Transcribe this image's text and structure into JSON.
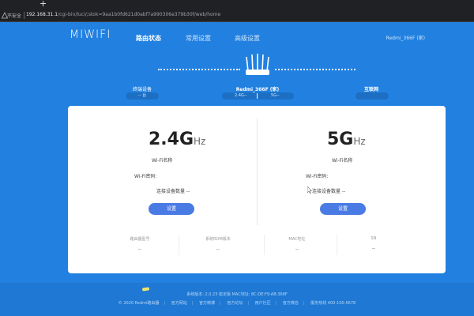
{
  "browser": {
    "new_tab": "+",
    "insecure_label": "不安全",
    "url_host": "192.168.31.1",
    "url_path": "/cgi-bin/luci/;stok=9aa1b0fd621d0abf7a990306e379b30f/web/home"
  },
  "header": {
    "logo": "MIWIFI",
    "nav": [
      "路由状态",
      "常用设置",
      "高级设置"
    ],
    "device_name": "Redmi_366F (家)"
  },
  "topology": {
    "left_label": "终端设备",
    "left_value": "-- 台",
    "center_label": "Redmi_366F (家)",
    "band_24": "2.4G--",
    "band_5": "5G--",
    "right_label": "互联网",
    "right_value": ""
  },
  "bands": [
    {
      "freq": "2.4G",
      "unit": "Hz",
      "wifi_name_label": "Wi-Fi名称",
      "wifi_pwd_label": "Wi-Fi密码:",
      "clients_label": "连接设备数量 --",
      "button": "设置"
    },
    {
      "freq": "5G",
      "unit": "Hz",
      "wifi_name_label": "Wi-Fi名称",
      "wifi_pwd_label": "Wi-Fi密码:",
      "clients_label": "连接设备数量 --",
      "button": "设置"
    }
  ],
  "info": [
    {
      "key": "路由器型号",
      "value": "--"
    },
    {
      "key": "系统ROM版本",
      "value": "--"
    },
    {
      "key": "MAC地址",
      "value": "--"
    },
    {
      "key": "SN",
      "value": "--"
    }
  ],
  "footer": {
    "line1": "系统版本: 2.0.23 稳定版   MAC地址: 8C:DE:F9:AB:366F",
    "links": [
      "© 2020 Redmi路由器",
      "官方网站",
      "官方微博",
      "官方论坛",
      "用户社区",
      "官方微信",
      "服务热线 400-100-5678"
    ]
  },
  "colors": {
    "background": "#2281e0",
    "card": "#ffffff",
    "button": "#4a7be4"
  }
}
